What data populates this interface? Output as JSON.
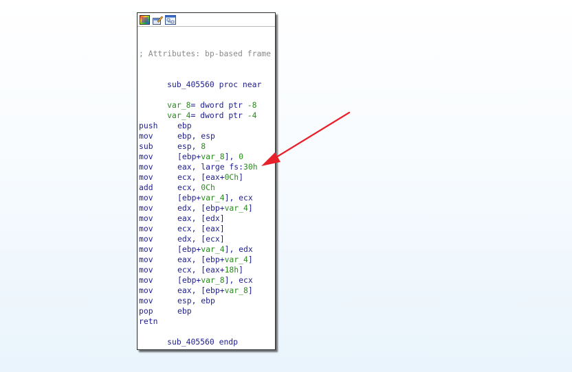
{
  "toolbar": {
    "icons": [
      "graph-color-icon",
      "edit-node-icon",
      "group-nodes-icon"
    ]
  },
  "colors": {
    "mnemonic": "#1d1d8f",
    "comment": "#8a8a8a",
    "variable": "#2a8a1f",
    "number": "#2a8a1f",
    "arrow": "#e8202a"
  },
  "listing": {
    "comment": "; Attributes: bp-based frame",
    "proc_name": "sub_405560",
    "proc_keyword": "proc near",
    "end_keyword": "endp",
    "vars": [
      {
        "name": "var_8",
        "suffix": "= dword ptr ",
        "offset": "-8"
      },
      {
        "name": "var_4",
        "suffix": "= dword ptr ",
        "offset": "-4"
      }
    ],
    "instructions": [
      {
        "m": "push",
        "ops": [
          {
            "t": "ebp",
            "c": "blue"
          }
        ]
      },
      {
        "m": "mov",
        "ops": [
          {
            "t": "ebp, esp",
            "c": "blue"
          }
        ]
      },
      {
        "m": "sub",
        "ops": [
          {
            "t": "esp, ",
            "c": "blue"
          },
          {
            "t": "8",
            "c": "num"
          }
        ]
      },
      {
        "m": "mov",
        "ops": [
          {
            "t": "[ebp+",
            "c": "blue"
          },
          {
            "t": "var_8",
            "c": "green"
          },
          {
            "t": "], ",
            "c": "blue"
          },
          {
            "t": "0",
            "c": "num"
          }
        ]
      },
      {
        "m": "mov",
        "ops": [
          {
            "t": "eax, large fs:",
            "c": "blue"
          },
          {
            "t": "30h",
            "c": "num"
          }
        ]
      },
      {
        "m": "mov",
        "ops": [
          {
            "t": "ecx, [eax+",
            "c": "blue"
          },
          {
            "t": "0Ch",
            "c": "num"
          },
          {
            "t": "]",
            "c": "blue"
          }
        ]
      },
      {
        "m": "add",
        "ops": [
          {
            "t": "ecx, ",
            "c": "blue"
          },
          {
            "t": "0Ch",
            "c": "num"
          }
        ]
      },
      {
        "m": "mov",
        "ops": [
          {
            "t": "[ebp+",
            "c": "blue"
          },
          {
            "t": "var_4",
            "c": "green"
          },
          {
            "t": "], ecx",
            "c": "blue"
          }
        ]
      },
      {
        "m": "mov",
        "ops": [
          {
            "t": "edx, [ebp+",
            "c": "blue"
          },
          {
            "t": "var_4",
            "c": "green"
          },
          {
            "t": "]",
            "c": "blue"
          }
        ]
      },
      {
        "m": "mov",
        "ops": [
          {
            "t": "eax, [edx]",
            "c": "blue"
          }
        ]
      },
      {
        "m": "mov",
        "ops": [
          {
            "t": "ecx, [eax]",
            "c": "blue"
          }
        ]
      },
      {
        "m": "mov",
        "ops": [
          {
            "t": "edx, [ecx]",
            "c": "blue"
          }
        ]
      },
      {
        "m": "mov",
        "ops": [
          {
            "t": "[ebp+",
            "c": "blue"
          },
          {
            "t": "var_4",
            "c": "green"
          },
          {
            "t": "], edx",
            "c": "blue"
          }
        ]
      },
      {
        "m": "mov",
        "ops": [
          {
            "t": "eax, [ebp+",
            "c": "blue"
          },
          {
            "t": "var_4",
            "c": "green"
          },
          {
            "t": "]",
            "c": "blue"
          }
        ]
      },
      {
        "m": "mov",
        "ops": [
          {
            "t": "ecx, [eax+",
            "c": "blue"
          },
          {
            "t": "18h",
            "c": "num"
          },
          {
            "t": "]",
            "c": "blue"
          }
        ]
      },
      {
        "m": "mov",
        "ops": [
          {
            "t": "[ebp+",
            "c": "blue"
          },
          {
            "t": "var_8",
            "c": "green"
          },
          {
            "t": "], ecx",
            "c": "blue"
          }
        ]
      },
      {
        "m": "mov",
        "ops": [
          {
            "t": "eax, [ebp+",
            "c": "blue"
          },
          {
            "t": "var_8",
            "c": "green"
          },
          {
            "t": "]",
            "c": "blue"
          }
        ]
      },
      {
        "m": "mov",
        "ops": [
          {
            "t": "esp, ebp",
            "c": "blue"
          }
        ]
      },
      {
        "m": "pop",
        "ops": [
          {
            "t": "ebp",
            "c": "blue"
          }
        ]
      },
      {
        "m": "retn",
        "ops": []
      }
    ]
  }
}
